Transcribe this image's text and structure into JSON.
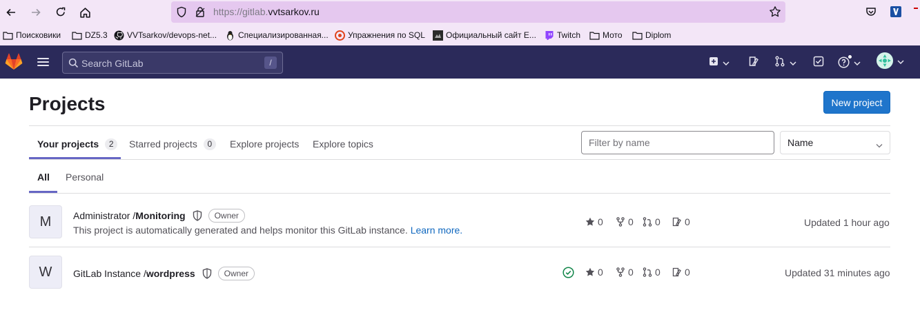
{
  "browser": {
    "url_prefix": "https://gitlab.",
    "url_domain": "vvtsarkov.ru",
    "bookmarks": [
      {
        "label": "Поисковики",
        "icon": "folder-icon"
      },
      {
        "label": "DZ5.3",
        "icon": "folder-icon"
      },
      {
        "label": "VVTsarkov/devops-net...",
        "icon": "github-icon"
      },
      {
        "label": "Специализированная...",
        "icon": "linux-penguin-icon"
      },
      {
        "label": "Упражнения по SQL",
        "icon": "sql-ex-icon"
      },
      {
        "label": "Официальный сайт E...",
        "icon": "site-icon"
      },
      {
        "label": "Twitch",
        "icon": "twitch-icon"
      },
      {
        "label": "Мото",
        "icon": "folder-icon"
      },
      {
        "label": "Diplom",
        "icon": "folder-icon"
      }
    ]
  },
  "gitlab_nav": {
    "search_placeholder": "Search GitLab",
    "search_shortcut": "/"
  },
  "page": {
    "title": "Projects",
    "new_project_label": "New project",
    "tabs": [
      {
        "label": "Your projects",
        "count": "2",
        "active": true
      },
      {
        "label": "Starred projects",
        "count": "0",
        "active": false
      },
      {
        "label": "Explore projects",
        "active": false
      },
      {
        "label": "Explore topics",
        "active": false
      }
    ],
    "filter_placeholder": "Filter by name",
    "sort_value": "Name",
    "subtabs": [
      {
        "label": "All",
        "active": true
      },
      {
        "label": "Personal",
        "active": false
      }
    ]
  },
  "projects": [
    {
      "avatar_letter": "M",
      "namespace": "Administrator / ",
      "name": "Monitoring",
      "role": "Owner",
      "description": "This project is automatically generated and helps monitor this GitLab instance. ",
      "learn_more": "Learn more.",
      "stars": "0",
      "forks": "0",
      "merge_requests": "0",
      "issues": "0",
      "updated": "Updated 1 hour ago",
      "pipeline_status": null
    },
    {
      "avatar_letter": "W",
      "namespace": "GitLab Instance / ",
      "name": "wordpress",
      "role": "Owner",
      "description": "",
      "stars": "0",
      "forks": "0",
      "merge_requests": "0",
      "issues": "0",
      "updated": "Updated 31 minutes ago",
      "pipeline_status": "passed"
    }
  ],
  "colors": {
    "nav_bg": "#2b2a5a",
    "primary_button": "#1f75cb",
    "tab_underline": "#6666c4",
    "pipeline_success": "#108548"
  }
}
